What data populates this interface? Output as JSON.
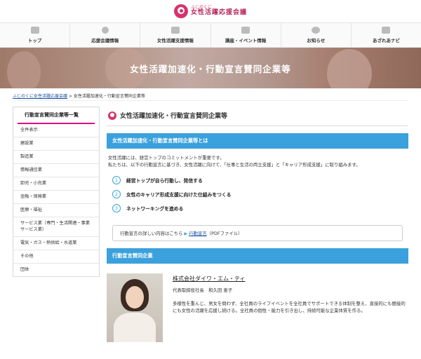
{
  "header": {
    "logo_small": "ふじのくに",
    "logo_big": "女性活躍応援会議"
  },
  "nav": [
    {
      "label": "トップ",
      "icon": "home-icon"
    },
    {
      "label": "応援会議情報",
      "icon": "logo-icon"
    },
    {
      "label": "女性活躍支援情報",
      "icon": "handshake-icon"
    },
    {
      "label": "講座・イベント情報",
      "icon": "pencil-icon"
    },
    {
      "label": "お知らせ",
      "icon": "chat-icon"
    },
    {
      "label": "あざれあナビ",
      "icon": "link-icon"
    }
  ],
  "banner": {
    "title": "女性活躍加速化・行動宣言賛同企業等"
  },
  "breadcrumb": {
    "home": "ふじのくに女性活躍応援会議",
    "sep": " > ",
    "current": "女性活躍加速化・行動宣言賛同企業等"
  },
  "sidebar": {
    "heading": "行動宣言賛同企業等一覧",
    "items": [
      "全件表示",
      "建設業",
      "製造業",
      "情報通信業",
      "卸売・小売業",
      "金融・保険業",
      "医療・福祉",
      "サービス業（専門・生活関連・事業サービス業）",
      "電気・ガス・熱供給・水道業",
      "その他",
      "団体"
    ]
  },
  "main": {
    "title": "女性活躍加速化・行動宣言賛同企業等",
    "section1": "女性活躍加速化・行動宣言賛同企業等とは",
    "intro_line1": "女性活躍には、経営トップのコミットメントが重要です。",
    "intro_line2": "私たちは、以下の行動宣言に基づき、女性活躍に向けて、「仕事と生活の両立支援」と「キャリア形成支援」に取り組みます。",
    "points": [
      {
        "num": "1",
        "text": "経営トップが自ら行動し、発信する"
      },
      {
        "num": "2",
        "text": "女性のキャリア形成支援に向けた仕組みをつくる"
      },
      {
        "num": "3",
        "text": "ネットワーキングを進める"
      }
    ],
    "info_prefix": "行動宣言の詳しい内容はこちら",
    "info_link": "行動宣言",
    "info_suffix": "（PDFファイル）",
    "section2": "行動宣言賛同企業",
    "company": {
      "name": "株式会社ダイワ・エム・ティ",
      "rep": "代表取締役社長　和久田 恵子",
      "desc": "多様性を重んじ、男女を問わず、全社員のライフイベントを全社員でサポートできる体制を整え、直接的にも間接的にも女性の活躍を応援し続ける。全社員の個性・能力を引き出し、持続可能な企業体質を作る。"
    }
  },
  "colors": {
    "accent_pink": "#e4007f",
    "section_blue": "#3aa1dc",
    "link_blue": "#1a4fa0"
  }
}
